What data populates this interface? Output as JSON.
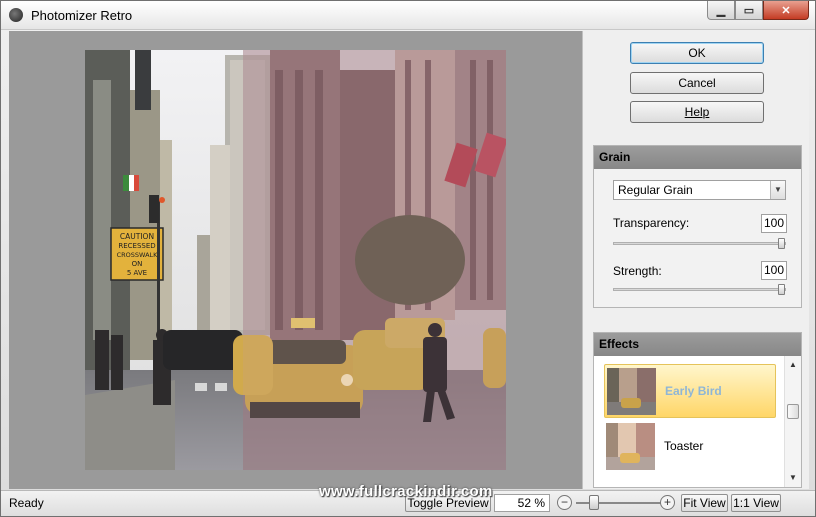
{
  "window": {
    "title": "Photomizer Retro",
    "controls": {
      "minimize_icon": "minimize-icon",
      "maximize_icon": "maximize-icon",
      "close_icon": "close-icon"
    }
  },
  "dialog_buttons": {
    "ok": "OK",
    "cancel": "Cancel",
    "help": "Help"
  },
  "grain": {
    "header": "Grain",
    "type_selected": "Regular Grain",
    "transparency_label": "Transparency:",
    "transparency_value": "100",
    "transparency_level_percent": 100,
    "strength_label": "Strength:",
    "strength_value": "100",
    "strength_level_percent": 100
  },
  "effects": {
    "header": "Effects",
    "items": [
      {
        "name": "Early Bird",
        "selected": true
      },
      {
        "name": "Toaster",
        "selected": false
      }
    ]
  },
  "status": {
    "text": "Ready",
    "toggle_preview": "Toggle Preview",
    "zoom": "52 %",
    "fit_view": "Fit View",
    "one_to_one": "1:1 View"
  },
  "watermark": "www.fullcrackindir.com",
  "colors": {
    "preview_background": "#9a9a9a",
    "panel_header": "#8f8f8f",
    "selected_effect": "#ffd667"
  },
  "preview_image": {
    "sign_text": [
      "CAUTION",
      "RECESSED",
      "CROSSWALK",
      "ON",
      "5 AVE"
    ]
  }
}
